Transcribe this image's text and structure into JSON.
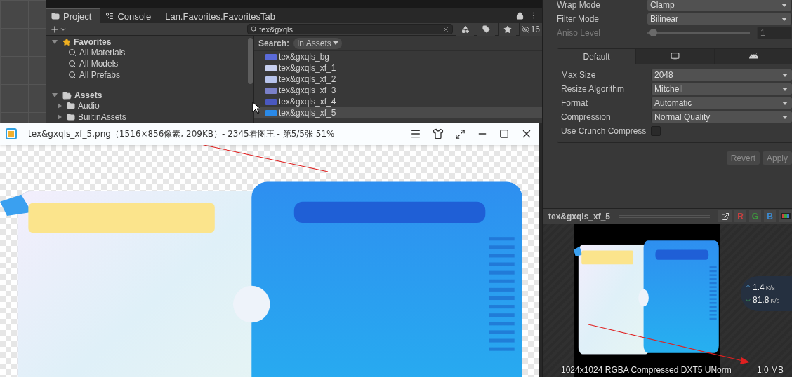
{
  "project_panel": {
    "tabs": [
      {
        "kind": "folder",
        "label": "Project",
        "selected": true
      },
      {
        "kind": "console",
        "label": "Console",
        "selected": false
      },
      {
        "kind": "plain",
        "label": "Lan.Favorites.FavoritesTab",
        "selected": false
      }
    ],
    "search": {
      "value": "tex&gxqls"
    },
    "hidden_count": "16",
    "tree": [
      {
        "kind": "favorites",
        "label": "Favorites",
        "expanded": true,
        "children": [
          {
            "kind": "search",
            "label": "All Materials"
          },
          {
            "kind": "search",
            "label": "All Models"
          },
          {
            "kind": "search",
            "label": "All Prefabs"
          }
        ]
      },
      {
        "kind": "assets",
        "label": "Assets",
        "expanded": true,
        "children": [
          {
            "kind": "folder",
            "label": "Audio",
            "expanded": false
          },
          {
            "kind": "folder",
            "label": "BuiltinAssets",
            "expanded": false
          }
        ]
      }
    ],
    "search_scope": {
      "label": "Search:",
      "value": "In Assets"
    },
    "results": [
      {
        "name": "tex&gxqls_bg",
        "selected": false
      },
      {
        "name": "tex&gxqls_xf_1",
        "selected": false
      },
      {
        "name": "tex&gxqls_xf_2",
        "selected": false
      },
      {
        "name": "tex&gxqls_xf_3",
        "selected": false
      },
      {
        "name": "tex&gxqls_xf_4",
        "selected": false
      },
      {
        "name": "tex&gxqls_xf_5",
        "selected": true
      }
    ]
  },
  "image_viewer": {
    "title": "tex&gxqls_xf_5.png（1516×856像素, 209KB）- 2345看图王 - 第5/5张 51%"
  },
  "inspector": {
    "rows": [
      {
        "kind": "dropdown",
        "label": "Wrap Mode",
        "value": "Clamp",
        "disabled": false
      },
      {
        "kind": "dropdown",
        "label": "Filter Mode",
        "value": "Bilinear",
        "disabled": false
      },
      {
        "kind": "slider",
        "label": "Aniso Level",
        "value": "1",
        "level": 0.06,
        "disabled": true
      }
    ],
    "platform_tabs": [
      {
        "kind": "default",
        "label": "Default",
        "selected": true
      },
      {
        "kind": "desktop",
        "selected": false
      },
      {
        "kind": "robot",
        "selected": false
      }
    ],
    "platform_rows": [
      {
        "kind": "dropdown",
        "label": "Max Size",
        "value": "2048"
      },
      {
        "kind": "dropdown",
        "label": "Resize Algorithm",
        "value": "Mitchell"
      },
      {
        "kind": "dropdown",
        "label": "Format",
        "value": "Automatic"
      },
      {
        "kind": "dropdown",
        "label": "Compression",
        "value": "Normal Quality"
      },
      {
        "kind": "checkbox",
        "label": "Use Crunch Compress",
        "checked": false
      }
    ],
    "buttons": [
      "Revert",
      "Apply"
    ]
  },
  "preview": {
    "title": "tex&gxqls_xf_5",
    "channels": [
      {
        "label": "R",
        "color": "#c84040"
      },
      {
        "label": "G",
        "color": "#3c9a3c"
      },
      {
        "label": "B",
        "color": "#3c8ad0"
      }
    ],
    "info": "1024x1024  RGBA Compressed DXT5 UNorm",
    "size": "1.0 MB"
  },
  "net_speed": {
    "upload": "1.4",
    "upload_unit": "K/s",
    "download": "81.8",
    "download_unit": "K/s"
  }
}
